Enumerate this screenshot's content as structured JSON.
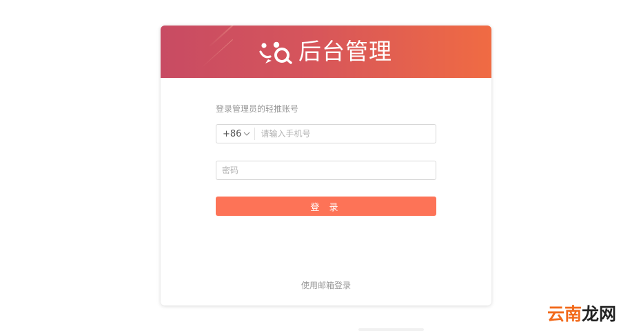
{
  "header": {
    "title": "后台管理",
    "logo_icon": "people-chat-logo-icon"
  },
  "form": {
    "label": "登录管理员的轻推账号",
    "country_code": "+86",
    "phone_placeholder": "请输入手机号",
    "password_placeholder": "密码",
    "login_label": "登 录",
    "email_login_label": "使用邮箱登录"
  },
  "watermark": {
    "part1": "云南",
    "part2": "龙网"
  },
  "colors": {
    "header_start": "#c84b63",
    "header_end": "#f06b43",
    "button": "#fd7357"
  }
}
